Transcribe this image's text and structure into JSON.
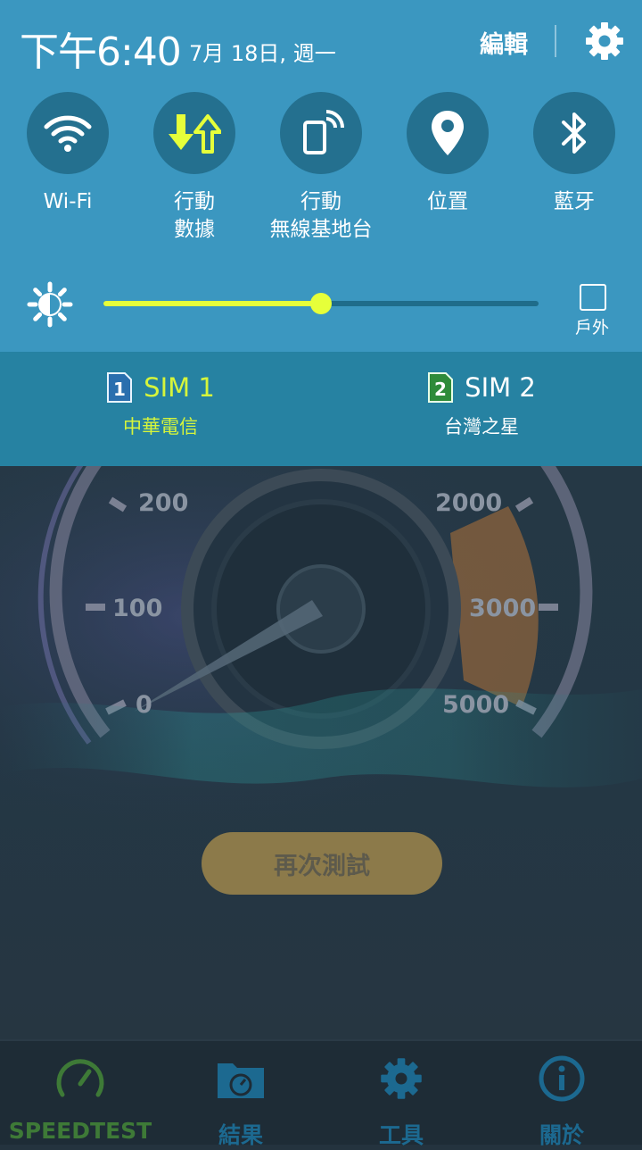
{
  "status": {
    "time": "下午6:40",
    "date": "7月 18日, 週一",
    "edit_label": "編輯"
  },
  "quick_settings": [
    {
      "label": "Wi-Fi",
      "icon": "wifi-icon",
      "active": false
    },
    {
      "label": "行動\n數據",
      "icon": "mobile-data-icon",
      "active": true
    },
    {
      "label": "行動\n無線基地台",
      "icon": "hotspot-icon",
      "active": false
    },
    {
      "label": "位置",
      "icon": "location-icon",
      "active": false
    },
    {
      "label": "藍牙",
      "icon": "bluetooth-icon",
      "active": false
    }
  ],
  "brightness": {
    "level": 0.5,
    "outdoor_label": "戶外"
  },
  "sims": [
    {
      "number": "1",
      "name": "SIM 1",
      "carrier": "中華電信",
      "active": true
    },
    {
      "number": "2",
      "name": "SIM 2",
      "carrier": "台灣之星",
      "active": false
    }
  ],
  "gauge": {
    "left_ticks": [
      "200",
      "100",
      "0"
    ],
    "right_ticks": [
      "2000",
      "3000",
      "5000"
    ]
  },
  "app": {
    "again_button": "再次測試"
  },
  "tabs": [
    {
      "label": "SPEEDTEST",
      "icon": "speedometer-icon",
      "active": true
    },
    {
      "label": "結果",
      "icon": "results-folder-icon",
      "active": false
    },
    {
      "label": "工具",
      "icon": "gear-icon",
      "active": false
    },
    {
      "label": "關於",
      "icon": "info-icon",
      "active": false
    }
  ],
  "colors": {
    "shade": "#3b97c0",
    "sim_bar": "#2682a2",
    "accent_yellow": "#e6ff3a",
    "sim1_text": "#d6f53b"
  }
}
